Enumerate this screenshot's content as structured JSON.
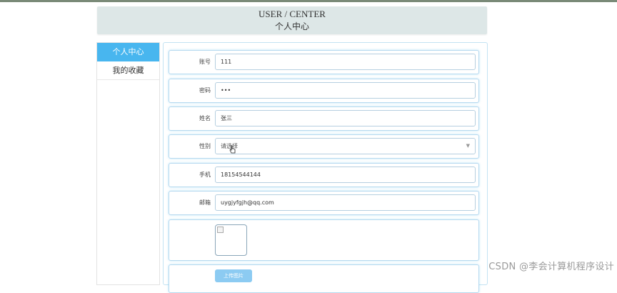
{
  "header": {
    "title_en": "USER / CENTER",
    "title_cn": "个人中心"
  },
  "sidebar": {
    "items": [
      {
        "label": "个人中心",
        "active": true
      },
      {
        "label": "我的收藏",
        "active": false
      }
    ]
  },
  "form": {
    "account": {
      "label": "账号",
      "value": "111"
    },
    "password": {
      "label": "密码",
      "value": "•••"
    },
    "name": {
      "label": "姓名",
      "value": "张三"
    },
    "gender": {
      "label": "性别",
      "placeholder": "请选择",
      "icon": "chevron-down-icon"
    },
    "phone": {
      "label": "手机",
      "value": "18154544144"
    },
    "email": {
      "label": "邮箱",
      "value": "uygjyfgjh@qq.com"
    },
    "avatar": {
      "icon": "broken-image-icon"
    },
    "upload": {
      "label": "上传图片"
    }
  },
  "watermark": "CSDN @李会计算机程序设计",
  "colors": {
    "accent": "#48b6ef",
    "header_bg": "#dde7e7",
    "row_border": "#b6d9ef"
  }
}
